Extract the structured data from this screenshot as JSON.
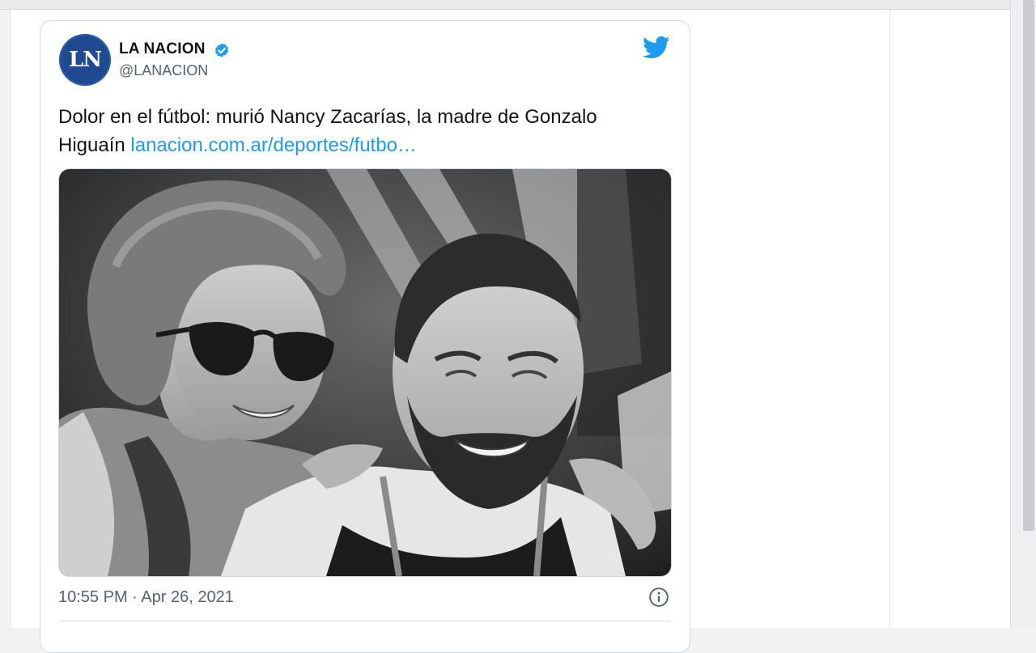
{
  "tweet": {
    "avatar_text": "LN",
    "account_name": "LA NACION",
    "handle": "@LANACION",
    "text": "Dolor en el fútbol: murió Nancy Zacarías, la madre de Gonzalo Higuaín ",
    "link_text": "lanacion.com.ar/deportes/futbo…",
    "timestamp": "10:55 PM · Apr 26, 2021",
    "icons": {
      "verified": "verified-badge-icon",
      "bird": "twitter-bird-icon",
      "info": "info-icon"
    },
    "colors": {
      "link": "#1d9bf0",
      "avatar_bg": "#1f4a8f",
      "text": "#0f1419",
      "muted": "#536471"
    },
    "image": "Black and white photo of a smiling woman in sunglasses beside a smiling bearded man"
  }
}
